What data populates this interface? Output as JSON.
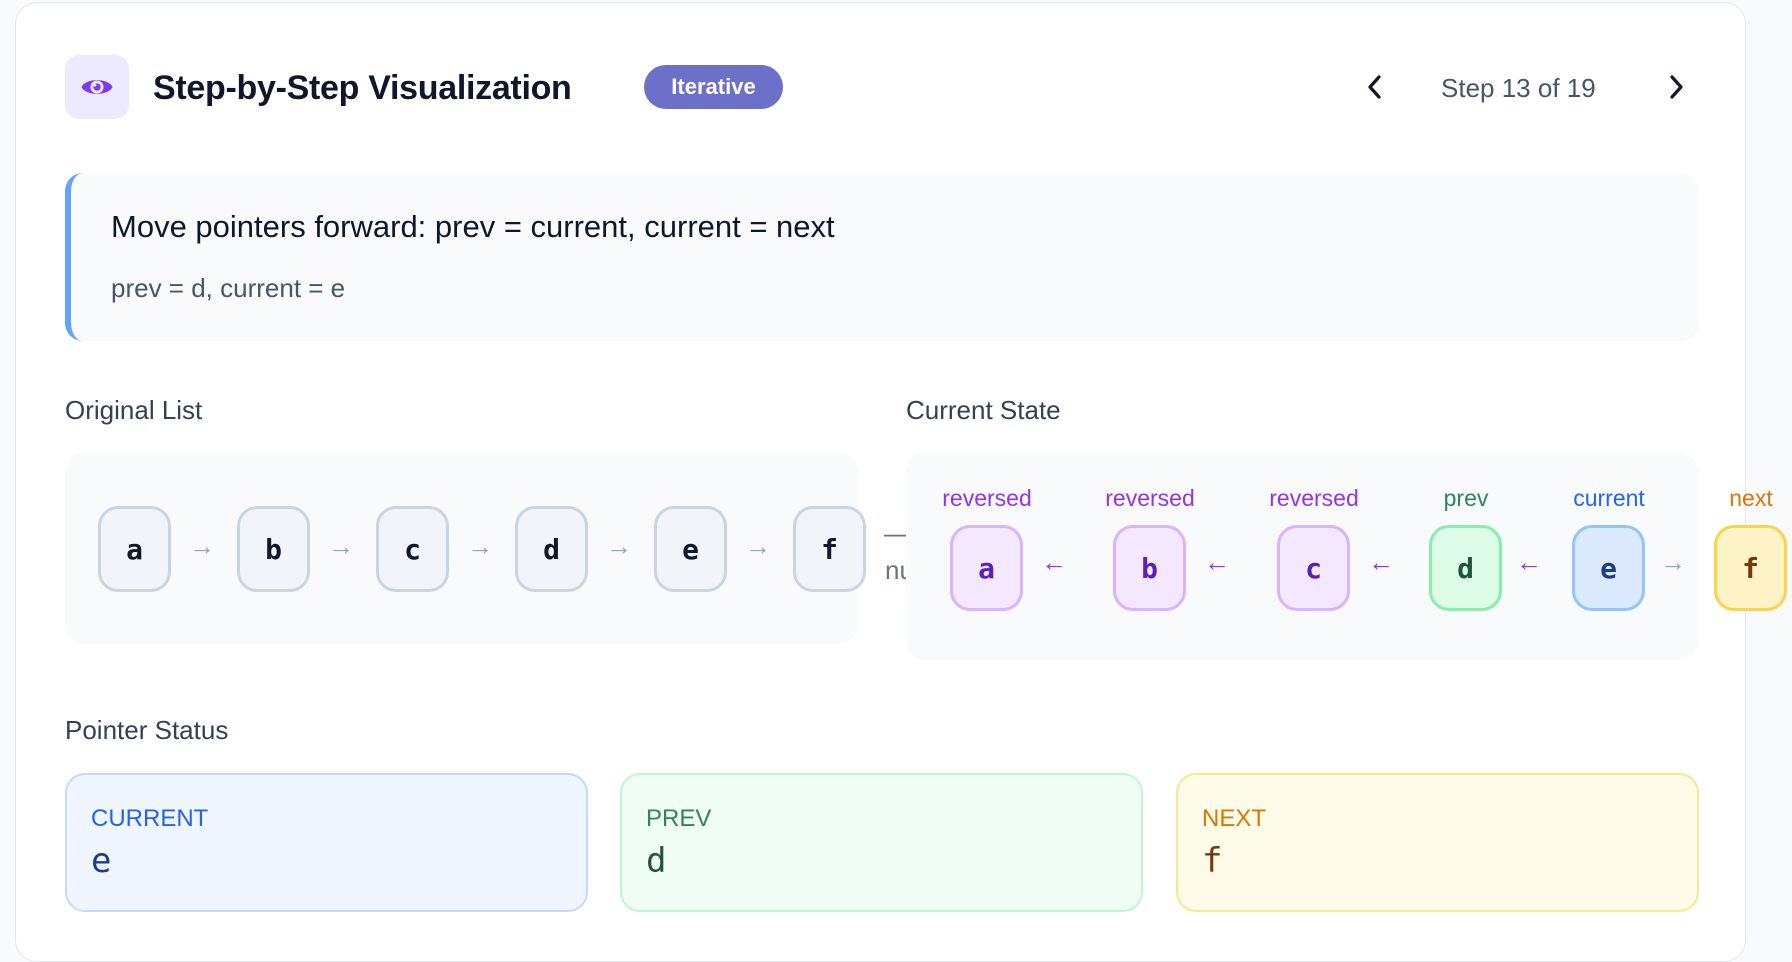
{
  "header": {
    "title": "Step-by-Step Visualization",
    "badge": "Iterative",
    "step_text": "Step 13 of 19",
    "icon": "eye-icon"
  },
  "description": {
    "title": "Move pointers forward: prev = current, current = next",
    "detail": "prev = d, current = e"
  },
  "original": {
    "label": "Original List",
    "nodes": [
      "a",
      "b",
      "c",
      "d",
      "e",
      "f"
    ],
    "arrow": "→",
    "tail": "null"
  },
  "current_state": {
    "label": "Current State",
    "nodes": [
      {
        "value": "a",
        "tag": "reversed",
        "arrow_after": "←"
      },
      {
        "value": "b",
        "tag": "reversed",
        "arrow_after": "←"
      },
      {
        "value": "c",
        "tag": "reversed",
        "arrow_after": "←"
      },
      {
        "value": "d",
        "tag": "prev",
        "arrow_after": "←"
      },
      {
        "value": "e",
        "tag": "current",
        "arrow_after": "→"
      },
      {
        "value": "f",
        "tag": "next"
      }
    ]
  },
  "pointers": {
    "label": "Pointer Status",
    "items": [
      {
        "label": "CURRENT",
        "value": "e"
      },
      {
        "label": "PREV",
        "value": "d"
      },
      {
        "label": "NEXT",
        "value": "f"
      }
    ]
  },
  "colors": {
    "reversed": "#9333ea",
    "prev": "#2f855a",
    "current": "#2563eb",
    "next": "#d97706",
    "badge": "#6d70c8",
    "accent": "#60a5fa"
  }
}
